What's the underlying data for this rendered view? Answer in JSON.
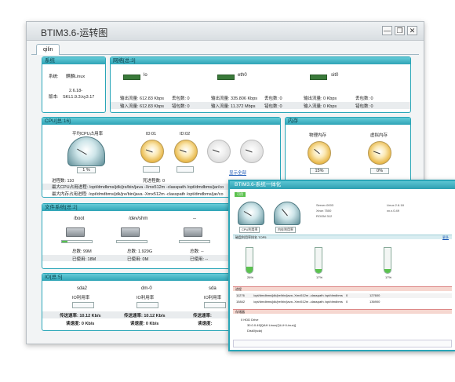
{
  "window": {
    "title": "BTIM3.6-运转图",
    "tab": "qilin",
    "btn_min": "—",
    "btn_max": "❐",
    "btn_close": "✕"
  },
  "system": {
    "header": "系统",
    "os_label": "系统:",
    "os_value": "麒麟Linux",
    "ver_label": "版本:",
    "ver_value1": "2.6.18-",
    "ver_value2": "SKL1.9.3.ky3.17"
  },
  "network": {
    "header": "网络[总:3]",
    "nics": [
      {
        "name": "lo",
        "out": "输出流量: 612.83 Kbps",
        "out_err": "丢包数: 0",
        "in": "输入流量: 612.83 Kbps",
        "in_err": "错包数: 0"
      },
      {
        "name": "eth0",
        "out": "输出流量: 335.806 Kbps",
        "out_err": "丢包数: 0",
        "in": "输入流量: 11.372 Mbps",
        "in_err": "错包数: 0"
      },
      {
        "name": "sit0",
        "out": "输出流量: 0 Kbps",
        "out_err": "丢包数: 0",
        "in": "输入流量: 0 Kbps",
        "in_err": "错包数: 0"
      }
    ]
  },
  "cpu": {
    "header": "CPU[总:16]",
    "avg_label": "平均CPU占用率",
    "avg_value": "1 %",
    "ids": [
      "ID:01",
      "ID:02"
    ],
    "show_all": "显示全部",
    "proc_count": "进程数: 110",
    "dead_count": "死进程数: 0",
    "max_cpu_proc": "最大CPU占用进程: /opt/dmdbms/jdk/jre/bin/java -Xmx512m -classpath /opt/dmdbms/jar/co",
    "max_mem_proc": "最大内存占用进程: /opt/dmdbms/jdk/jre/bin/java -Xmx512m -classpath /opt/dmdbms/jar/co"
  },
  "memory": {
    "header": "内存",
    "physical_label": "物理内存",
    "physical_value": "15%",
    "virtual_label": "虚拟内存",
    "virtual_value": "0%"
  },
  "filesystem": {
    "header": "文件系统[总:2]",
    "items": [
      {
        "mount": "/boot",
        "total": "总数: 99M",
        "used": "已使用: 18M",
        "usage": 0.18
      },
      {
        "mount": "/dev/shm",
        "total": "总数: 1.929G",
        "used": "已使用: 0M",
        "usage": 0.0
      },
      {
        "mount": "--",
        "total": "总数: --",
        "used": "已使用: --",
        "usage": 0.0
      }
    ]
  },
  "io": {
    "header": "IO[总:5]",
    "items": [
      {
        "name": "sda2",
        "label": "IO利用率",
        "send": "传送速率: 10.12 Kb/s",
        "read": "读速度: 0 Kb/s"
      },
      {
        "name": "dm-0",
        "label": "IO利用率",
        "send": "传送速率: 10.12 Kb/s",
        "read": "读速度: 0 Kb/s"
      },
      {
        "name": "sda",
        "label": "IO利用率",
        "send": "传送速率:",
        "read": "读速度:"
      }
    ]
  },
  "detail": {
    "title": "BTIM3.6-系统一体化",
    "status": "可用",
    "cpu_label": "CPU利用率",
    "mem_label": "内存利用率",
    "hosts": [
      "Server-0003",
      "Xeon 7500",
      "ROOM 312",
      "Linux 2.6.18",
      "xx.x.0.49"
    ],
    "sec_top": "磁盘利用率排名 TOP5",
    "sec_proc": "进程",
    "sec_disk": "存储器",
    "more": "更多",
    "tubes": [
      {
        "label": "26%",
        "level": 0.26
      },
      {
        "label": "17%",
        "level": 0.17
      },
      {
        "label": "17%",
        "level": 0.17
      }
    ],
    "proc_rows": [
      [
        "11276",
        "/opt/dmdbms/jdk/jre/bin/java -Xmx512m -classpath /opt/dmdbms",
        "0",
        "127600",
        "cpu"
      ],
      [
        "15842",
        "/opt/dmdbms/jdk/jre/bin/java -Xmx512m -classpath /opt/dmdbms",
        "0",
        "136900",
        "mem"
      ]
    ],
    "disk_rows": [
      "0 HDD Drive",
      "30.0.0.49[QAH Linux(QLLH Linux)]",
      "Disk0(sda)"
    ]
  },
  "colors": {
    "accent": "#2aa6b8",
    "header": "#66cbd8",
    "ok": "#57c14e"
  }
}
